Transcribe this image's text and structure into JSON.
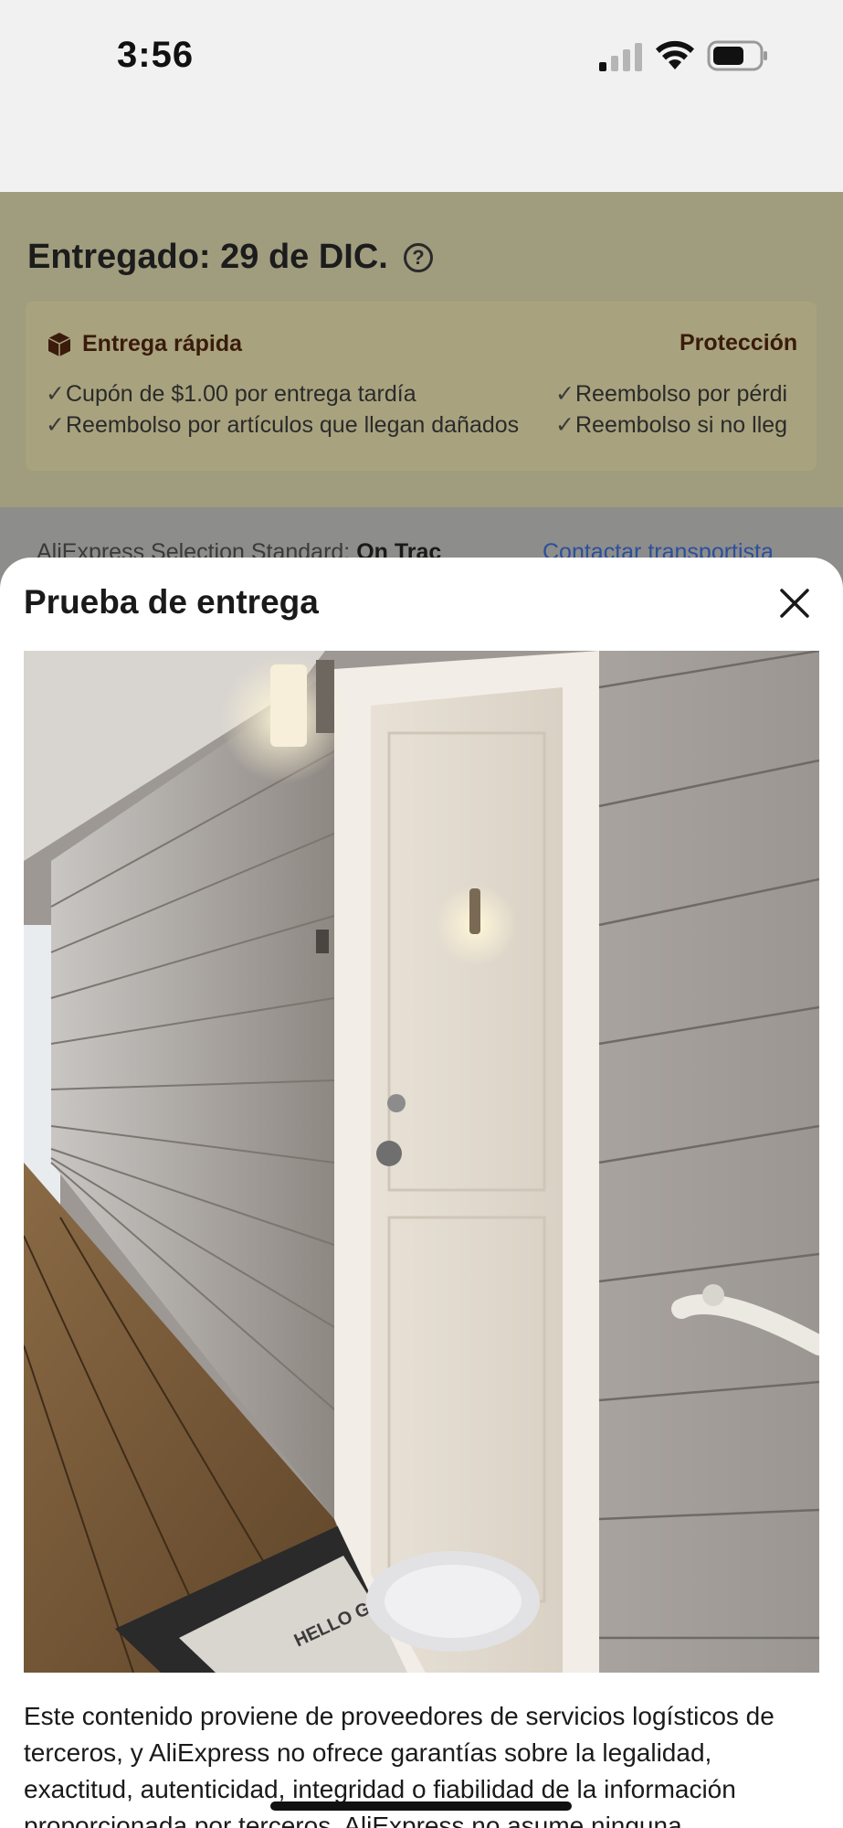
{
  "status_bar": {
    "time": "3:56"
  },
  "delivery": {
    "title": "Entregado: 29 de DIC.",
    "fast_delivery": {
      "title": "Entrega rápida",
      "benefits": [
        "Cupón de $1.00 por entrega tardía",
        "Reembolso por artículos que llegan dañados"
      ]
    },
    "protection": {
      "title": "Protección",
      "benefits": [
        "Reembolso por pérdi",
        "Reembolso si no lleg"
      ]
    },
    "carrier_prefix": "AliExpress Selection Standard:",
    "carrier_name": "On Trac",
    "contact_carrier": "Contactar transportista"
  },
  "sheet": {
    "title": "Prueba de entrega",
    "doormat_text": "HELLO GREETINGS FROM NORTH CAROLINA",
    "disclaimer": "Este contenido proviene de proveedores de servicios logísticos de terceros, y AliExpress no ofrece garantías sobre la legalidad, exactitud, autenticidad, integridad o fiabilidad de la información proporcionada por terceros. AliExpress no asume ninguna"
  },
  "colors": {
    "overlay_bg": "#8d8d8b",
    "benefit_title": "#3a1b0c",
    "link": "#2c4f9b",
    "sheet_bg": "#ffffff"
  }
}
